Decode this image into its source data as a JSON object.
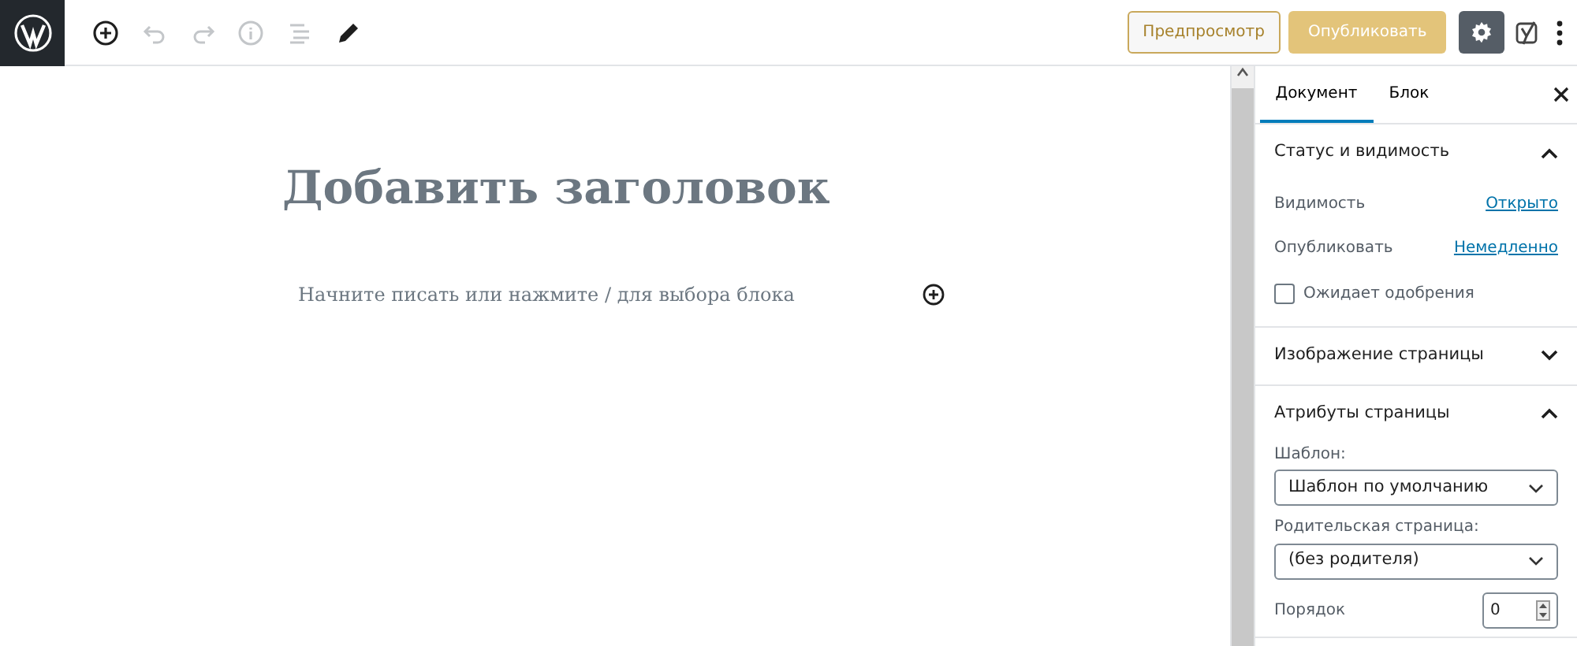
{
  "toolbar": {
    "tools": [
      {
        "kind": "add",
        "disabled": false
      },
      {
        "kind": "undo",
        "disabled": true
      },
      {
        "kind": "redo",
        "disabled": true
      },
      {
        "kind": "info",
        "disabled": true
      },
      {
        "kind": "outline",
        "disabled": true
      },
      {
        "kind": "edit",
        "disabled": false
      }
    ],
    "preview_button": "Предпросмотр",
    "publish_button": {
      "label": "Опубликовать",
      "disabled": true
    },
    "settings_toggle": {
      "selected": true
    }
  },
  "editor": {
    "title_placeholder": "Добавить заголовок",
    "body_placeholder": "Начните писать или нажмите / для выбора блока"
  },
  "sidebar": {
    "tabs": [
      {
        "label": "Документ",
        "selected": true
      },
      {
        "label": "Блок",
        "selected": false
      }
    ],
    "panels": [
      {
        "title": "Статус и видимость",
        "expanded": true,
        "rows": [
          {
            "kind": "link",
            "label": "Видимость",
            "value": "Открыто"
          },
          {
            "kind": "link",
            "label": "Опубликовать",
            "value": "Немедленно"
          },
          {
            "kind": "checkbox",
            "label": "Ожидает одобрения",
            "checked": false
          }
        ]
      },
      {
        "title": "Изображение страницы",
        "expanded": false
      },
      {
        "title": "Атрибуты страницы",
        "expanded": true,
        "rows": [
          {
            "kind": "select",
            "label": "Шаблон:",
            "value": "Шаблон по умолчанию"
          },
          {
            "kind": "select",
            "label": "Родительская страница:",
            "value": "(без родителя)"
          },
          {
            "kind": "number",
            "label": "Порядок",
            "value": "0"
          }
        ]
      }
    ]
  }
}
